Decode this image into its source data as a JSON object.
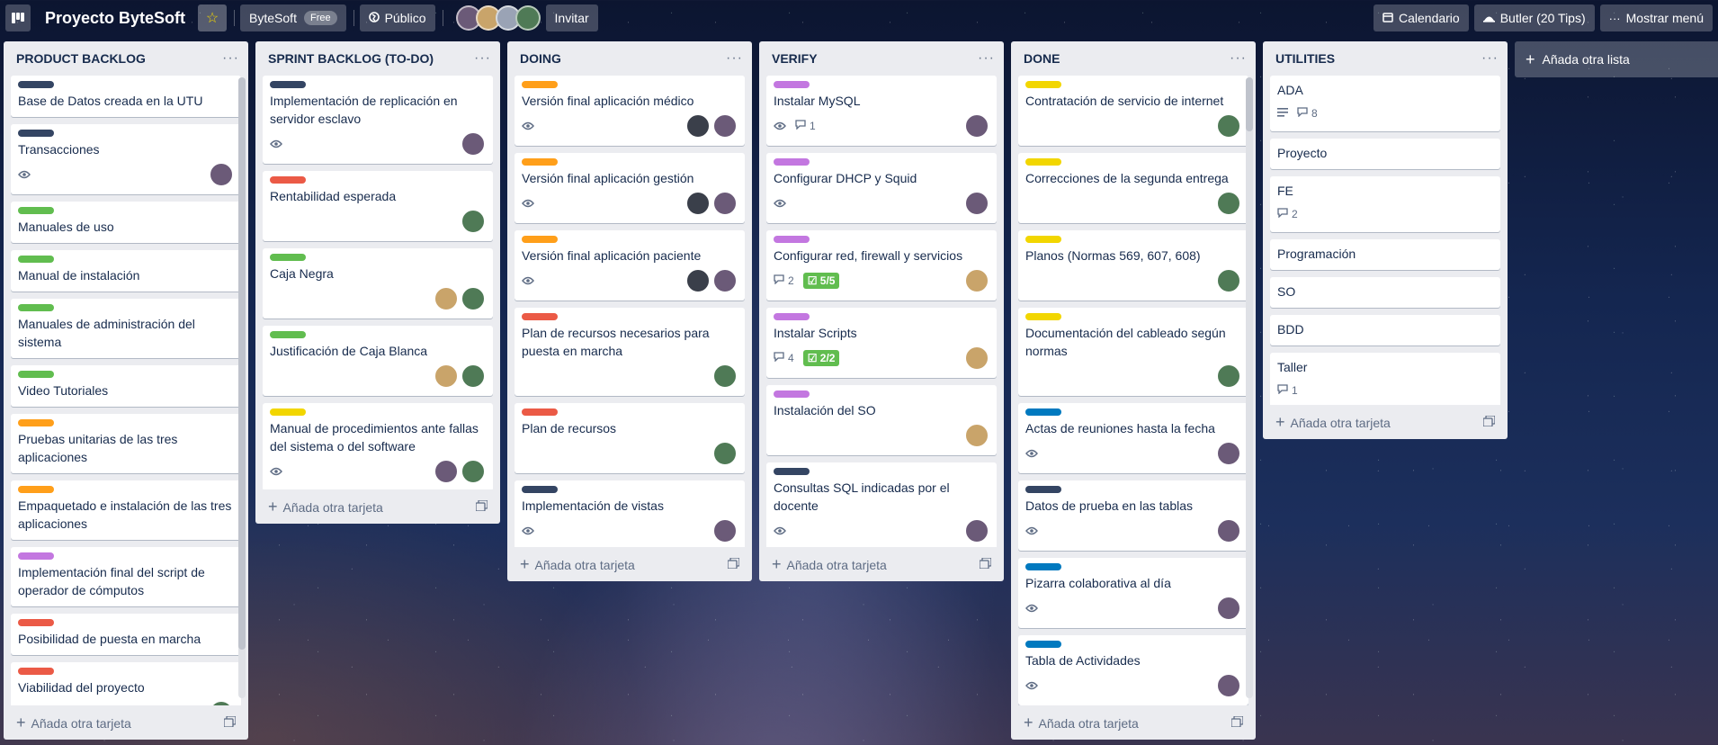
{
  "header": {
    "board_title": "Proyecto ByteSoft",
    "workspace": "ByteSoft",
    "plan_badge": "Free",
    "visibility": "Público",
    "invite": "Invitar",
    "calendar": "Calendario",
    "butler": "Butler (20 Tips)",
    "show_menu": "Mostrar menú",
    "icons": {
      "board": "board-icon",
      "star": "star-icon",
      "visibility": "globe-icon",
      "calendar": "calendar-icon",
      "butler": "butler-icon",
      "menu": "ellipsis-icon"
    }
  },
  "add_card_label": "Añada otra tarjeta",
  "add_list_label": "Añada otra lista",
  "colors": {
    "navy": "#344563",
    "green": "#61bd4f",
    "orange": "#ff9f1a",
    "red": "#eb5a46",
    "purple": "#c377e0",
    "yellow": "#f2d600",
    "blue": "#0079bf",
    "avatar_a": "#6b5a78",
    "avatar_b": "#4f7a56",
    "avatar_c": "#c9a46a",
    "avatar_d": "#3a3f4a"
  },
  "lists": [
    {
      "title": "PRODUCT BACKLOG",
      "cards": [
        {
          "label": "navy",
          "title": "Base de Datos creada en la UTU",
          "eye": false,
          "members": []
        },
        {
          "label": "navy",
          "title": "Transacciones",
          "eye": true,
          "members": [
            "avatar_a"
          ]
        },
        {
          "label": "green",
          "title": "Manuales de uso",
          "members": []
        },
        {
          "label": "green",
          "title": "Manual de instalación",
          "members": []
        },
        {
          "label": "green",
          "title": "Manuales de administración del sistema",
          "members": []
        },
        {
          "label": "green",
          "title": "Video Tutoriales",
          "members": []
        },
        {
          "label": "orange",
          "title": "Pruebas unitarias de las tres aplicaciones",
          "members": []
        },
        {
          "label": "orange",
          "title": "Empaquetado e instalación de las tres aplicaciones",
          "members": []
        },
        {
          "label": "purple",
          "title": "Implementación final del script de operador de cómputos",
          "members": []
        },
        {
          "label": "red",
          "title": "Posibilidad de puesta en marcha",
          "members": []
        },
        {
          "label": "red",
          "title": "Viabilidad del proyecto",
          "members": [
            "avatar_b"
          ]
        }
      ]
    },
    {
      "title": "SPRINT BACKLOG (TO-DO)",
      "cards": [
        {
          "label": "navy",
          "title": "Implementación de replicación en servidor esclavo",
          "eye": true,
          "members": [
            "avatar_a"
          ]
        },
        {
          "label": "red",
          "title": "Rentabilidad esperada",
          "members": [
            "avatar_b"
          ]
        },
        {
          "label": "green",
          "title": "Caja Negra",
          "members": [
            "avatar_c",
            "avatar_b"
          ]
        },
        {
          "label": "green",
          "title": "Justificación de Caja Blanca",
          "members": [
            "avatar_c",
            "avatar_b"
          ]
        },
        {
          "label": "yellow",
          "title": "Manual de procedimientos ante fallas del sistema o del software",
          "eye": true,
          "members": [
            "avatar_a",
            "avatar_b"
          ]
        }
      ]
    },
    {
      "title": "DOING",
      "cards": [
        {
          "label": "orange",
          "title": "Versión final aplicación médico",
          "eye": true,
          "members": [
            "avatar_d",
            "avatar_a"
          ]
        },
        {
          "label": "orange",
          "title": "Versión final aplicación gestión",
          "eye": true,
          "members": [
            "avatar_d",
            "avatar_a"
          ]
        },
        {
          "label": "orange",
          "title": "Versión final aplicación paciente",
          "eye": true,
          "members": [
            "avatar_d",
            "avatar_a"
          ]
        },
        {
          "label": "red",
          "title": "Plan de recursos necesarios para puesta en marcha",
          "members": [
            "avatar_b"
          ]
        },
        {
          "label": "red",
          "title": "Plan de recursos",
          "members": [
            "avatar_b"
          ]
        },
        {
          "label": "navy",
          "title": "Implementación de vistas",
          "eye": true,
          "members": [
            "avatar_a"
          ]
        }
      ]
    },
    {
      "title": "VERIFY",
      "cards": [
        {
          "label": "purple",
          "title": "Instalar MySQL",
          "eye": true,
          "comments": "1",
          "members": [
            "avatar_a"
          ]
        },
        {
          "label": "purple",
          "title": "Configurar DHCP y Squid",
          "eye": true,
          "members": [
            "avatar_a"
          ]
        },
        {
          "label": "purple",
          "title": "Configurar red, firewall y servicios",
          "comments": "2",
          "checklist": "5/5",
          "members": [
            "avatar_c"
          ]
        },
        {
          "label": "purple",
          "title": "Instalar Scripts",
          "comments": "4",
          "checklist": "2/2",
          "members": [
            "avatar_c"
          ]
        },
        {
          "label": "purple",
          "title": "Instalación del SO",
          "members": [
            "avatar_c"
          ]
        },
        {
          "label": "navy",
          "title": "Consultas SQL indicadas por el docente",
          "eye": true,
          "members": [
            "avatar_a"
          ]
        }
      ]
    },
    {
      "title": "DONE",
      "cards": [
        {
          "label": "yellow",
          "title": "Contratación de servicio de internet",
          "members": [
            "avatar_b"
          ]
        },
        {
          "label": "yellow",
          "title": "Correcciones de la segunda entrega",
          "members": [
            "avatar_b"
          ]
        },
        {
          "label": "yellow",
          "title": "Planos (Normas 569, 607, 608)",
          "members": [
            "avatar_b"
          ]
        },
        {
          "label": "yellow",
          "title": "Documentación del cableado según normas",
          "members": [
            "avatar_b"
          ]
        },
        {
          "label": "blue",
          "title": "Actas de reuniones hasta la fecha",
          "eye": true,
          "members": [
            "avatar_a"
          ]
        },
        {
          "label": "navy",
          "title": "Datos de prueba en las tablas",
          "eye": true,
          "members": [
            "avatar_a"
          ]
        },
        {
          "label": "blue",
          "title": "Pizarra colaborativa al día",
          "eye": true,
          "members": [
            "avatar_a"
          ]
        },
        {
          "label": "blue",
          "title": "Tabla de Actividades",
          "eye": true,
          "members": [
            "avatar_a"
          ]
        }
      ]
    },
    {
      "title": "UTILITIES",
      "cards": [
        {
          "title": "ADA",
          "description": true,
          "comments": "8",
          "members": []
        },
        {
          "title": "Proyecto",
          "members": []
        },
        {
          "title": "FE",
          "comments": "2",
          "members": []
        },
        {
          "title": "Programación",
          "members": []
        },
        {
          "title": "SO",
          "members": []
        },
        {
          "title": "BDD",
          "members": []
        },
        {
          "title": "Taller",
          "comments": "1",
          "members": []
        }
      ]
    }
  ]
}
